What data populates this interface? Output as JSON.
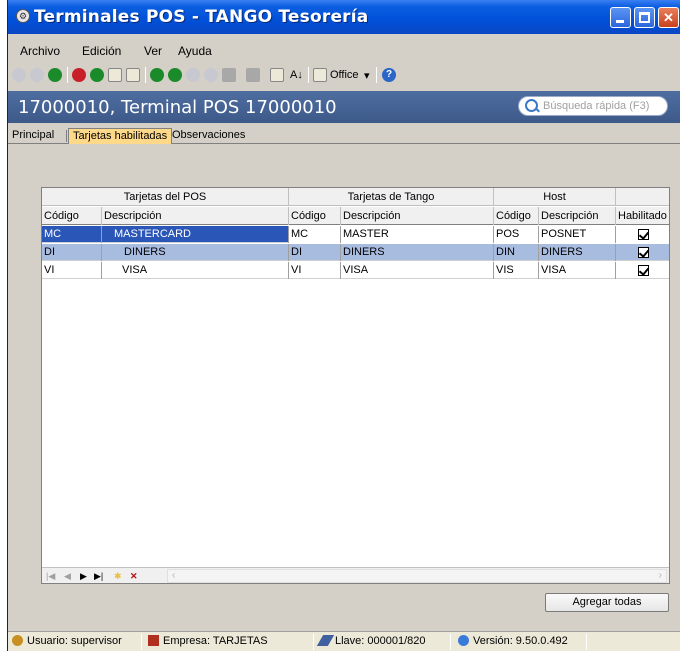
{
  "window": {
    "title": "Terminales POS - TANGO Tesorería"
  },
  "menu": [
    {
      "label": "Archivo"
    },
    {
      "label": "Edición"
    },
    {
      "label": "Ver"
    },
    {
      "label": "Ayuda"
    }
  ],
  "toolbar": {
    "office_label": "Office",
    "sort_label": "A↓"
  },
  "header": {
    "title": "17000010, Terminal POS 17000010",
    "search_placeholder": "Búsqueda rápida (F3)"
  },
  "tabs": [
    {
      "label": "Principal",
      "active": false
    },
    {
      "label": "Tarjetas habilitadas",
      "active": true
    },
    {
      "label": "Observaciones",
      "active": false
    }
  ],
  "grid": {
    "groups": [
      "Tarjetas del POS",
      "Tarjetas de Tango",
      "Host"
    ],
    "columns": [
      "Código",
      "Descripción",
      "Código",
      "Descripción",
      "Código",
      "Descripción",
      "Habilitado"
    ],
    "rows": [
      {
        "pos_code": "MC",
        "pos_desc": "MASTERCARD",
        "tango_code": "MC",
        "tango_desc": "MASTER",
        "host_code": "POS",
        "host_desc": "POSNET",
        "enabled": true
      },
      {
        "pos_code": "DI",
        "pos_desc": "DINERS",
        "tango_code": "DI",
        "tango_desc": "DINERS",
        "host_code": "DIN",
        "host_desc": "DINERS",
        "enabled": true
      },
      {
        "pos_code": "VI",
        "pos_desc": "VISA",
        "tango_code": "VI",
        "tango_desc": "VISA",
        "host_code": "VIS",
        "host_desc": "VISA",
        "enabled": true
      }
    ]
  },
  "buttons": {
    "add_all": "Agregar todas"
  },
  "status": {
    "user": "Usuario: supervisor",
    "company": "Empresa: TARJETAS",
    "key": "Llave: 000001/820",
    "version": "Versión: 9.50.0.492"
  },
  "colors": {
    "titlebar": "#0050d8",
    "header_band": "#4f6ea0",
    "active_tab": "#ffd98a",
    "selected_row": "#2a56b8",
    "alt_row": "#a8bce0"
  }
}
